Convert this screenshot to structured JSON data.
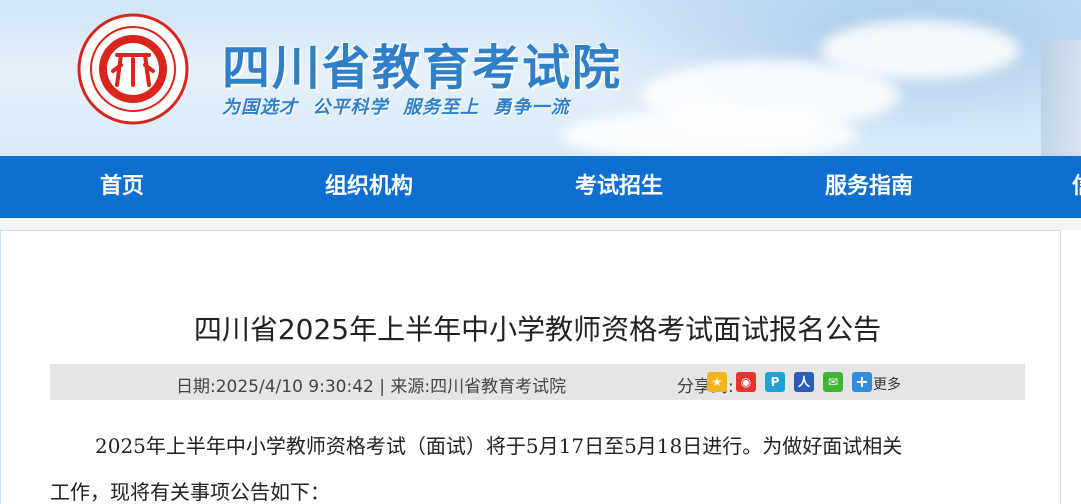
{
  "header": {
    "site_title": "四川省教育考试院",
    "slogan": "为国选才  公平科学  服务至上  勇争一流",
    "logo_color": "#d9251d"
  },
  "nav": {
    "items": [
      {
        "label": "首页"
      },
      {
        "label": "组织机构"
      },
      {
        "label": "考试招生"
      },
      {
        "label": "服务指南"
      },
      {
        "label": "信"
      }
    ],
    "bg_color": "#0f6fd1"
  },
  "article": {
    "title": "四川省2025年上半年中小学教师资格考试面试报名公告",
    "meta": "日期:2025/4/10 9:30:42 | 来源:四川省教育考试院",
    "share_label": "分享到:",
    "share_icons": [
      "qzone-icon",
      "weibo-icon",
      "tencent-weibo-icon",
      "renren-icon",
      "wechat-icon",
      "more-share-icon"
    ],
    "share_more": "更多",
    "paragraph_line1": "2025年上半年中小学教师资格考试（面试）将于5月17日至5月18日进行。为做好面试相关",
    "paragraph_line2": "工作，现将有关事项公告如下："
  }
}
